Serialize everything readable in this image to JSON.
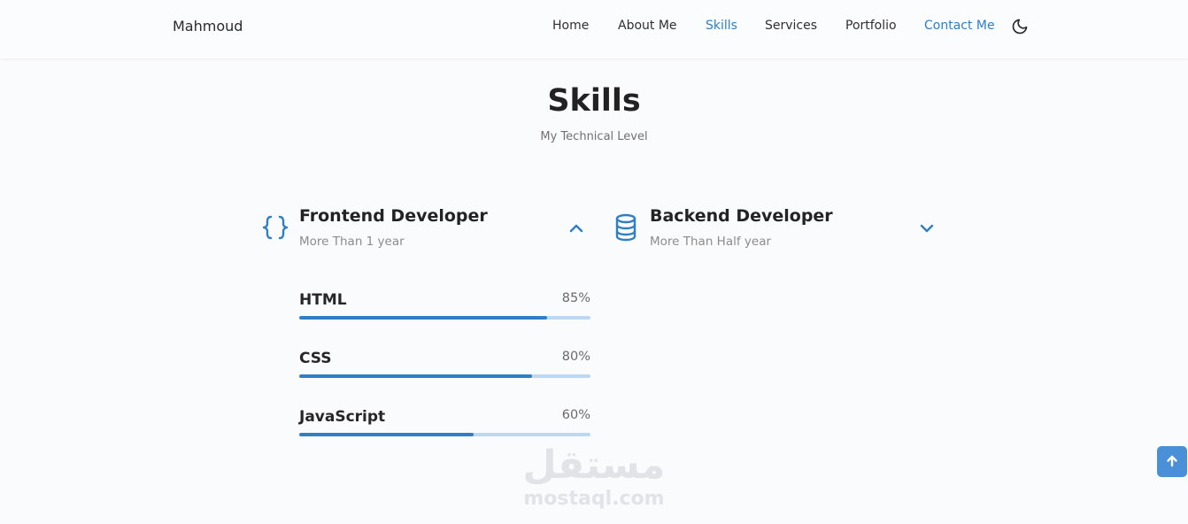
{
  "header": {
    "brand": "Mahmoud",
    "nav": [
      {
        "label": "Home",
        "active": false
      },
      {
        "label": "About Me",
        "active": false
      },
      {
        "label": "Skills",
        "active": true
      },
      {
        "label": "Services",
        "active": false
      },
      {
        "label": "Portfolio",
        "active": false
      },
      {
        "label": "Contact Me",
        "active": true
      }
    ],
    "theme_icon": "moon-icon"
  },
  "section": {
    "title": "Skills",
    "subtitle": "My Technical Level"
  },
  "frontend": {
    "title": "Frontend Developer",
    "subtitle": "More Than 1 year",
    "icon": "code-braces-icon",
    "toggle_icon": "chevron-up-icon",
    "expanded": true,
    "skills": [
      {
        "name": "HTML",
        "percent_label": "85%",
        "level": 85
      },
      {
        "name": "CSS",
        "percent_label": "80%",
        "level": 80
      },
      {
        "name": "JavaScript",
        "percent_label": "60%",
        "level": 60
      }
    ]
  },
  "backend": {
    "title": "Backend Developer",
    "subtitle": "More Than Half year",
    "icon": "database-icon",
    "toggle_icon": "chevron-down-icon",
    "expanded": false
  },
  "scroll_button_icon": "arrow-up-icon",
  "watermark": {
    "arabic": "مستقل",
    "latin": "mostaql.com"
  },
  "colors": {
    "accent": "#2e7fc6",
    "bar_track": "#bcd8f2",
    "background": "#fafbfd",
    "scroll_button": "#4a90d9"
  }
}
